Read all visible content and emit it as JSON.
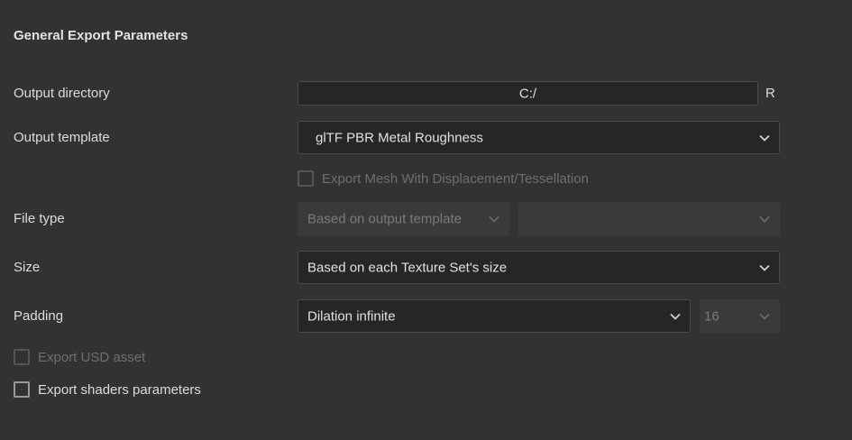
{
  "section": {
    "title": "General Export Parameters"
  },
  "output_directory": {
    "label": "Output directory",
    "value": "C:/",
    "reset_label": "R"
  },
  "output_template": {
    "label": "Output template",
    "value": "glTF PBR Metal Roughness"
  },
  "export_mesh_displacement": {
    "label": "Export Mesh With Displacement/Tessellation",
    "checked": false,
    "enabled": false
  },
  "file_type": {
    "label": "File type",
    "format_value": "Based on output template",
    "bit_depth_value": ""
  },
  "size": {
    "label": "Size",
    "value": "Based on each Texture Set's size"
  },
  "padding": {
    "label": "Padding",
    "value": "Dilation infinite",
    "distance_value": "16"
  },
  "export_usd": {
    "label": "Export USD asset",
    "checked": false,
    "enabled": false
  },
  "export_shaders": {
    "label": "Export shaders parameters",
    "checked": false,
    "enabled": true
  },
  "icons": {
    "dropdown": "chevron-down-icon"
  }
}
